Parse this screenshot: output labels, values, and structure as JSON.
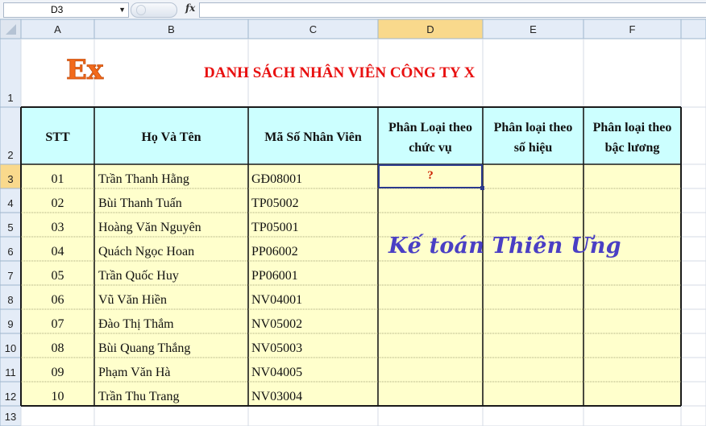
{
  "formula_bar": {
    "name_box": "D3",
    "fx_label": "fx",
    "formula": ""
  },
  "columns": [
    "A",
    "B",
    "C",
    "D",
    "E",
    "F"
  ],
  "rows": [
    "1",
    "2",
    "3",
    "4",
    "5",
    "6",
    "7",
    "8",
    "9",
    "10",
    "11",
    "12",
    "13"
  ],
  "selected": {
    "column": "D",
    "row": "3"
  },
  "title": "DANH SÁCH NHÂN VIÊN CÔNG TY X",
  "logo_text": "Ex",
  "watermark": "Kế toán Thiên Ưng",
  "headers": [
    "STT",
    "Họ Và Tên",
    "Mã Số Nhân Viên",
    "Phân Loại theo chức vụ",
    "Phân loại theo số hiệu",
    "Phân loại theo bậc lương"
  ],
  "header_lines": [
    [
      "STT"
    ],
    [
      "Họ Và Tên"
    ],
    [
      "Mã Số Nhân Viên"
    ],
    [
      "Phân Loại theo",
      "chức vụ"
    ],
    [
      "Phân loại theo",
      "số hiệu"
    ],
    [
      "Phân loại theo",
      "bậc lương"
    ]
  ],
  "table_rows": [
    {
      "stt": "01",
      "name": "Trần Thanh Hằng",
      "code": "GĐ08001",
      "d": "?",
      "e": "",
      "f": ""
    },
    {
      "stt": "02",
      "name": "Bùi Thanh Tuấn",
      "code": "TP05002",
      "d": "",
      "e": "",
      "f": ""
    },
    {
      "stt": "03",
      "name": "Hoàng Văn Nguyên",
      "code": "TP05001",
      "d": "",
      "e": "",
      "f": ""
    },
    {
      "stt": "04",
      "name": "Quách Ngọc Hoan",
      "code": "PP06002",
      "d": "",
      "e": "",
      "f": ""
    },
    {
      "stt": "05",
      "name": "Trần Quốc Huy",
      "code": "PP06001",
      "d": "",
      "e": "",
      "f": ""
    },
    {
      "stt": "06",
      "name": "Vũ Văn Hiền",
      "code": "NV04001",
      "d": "",
      "e": "",
      "f": ""
    },
    {
      "stt": "07",
      "name": "Đào Thị Thắm",
      "code": "NV05002",
      "d": "",
      "e": "",
      "f": ""
    },
    {
      "stt": "08",
      "name": "Bùi Quang Thắng",
      "code": "NV05003",
      "d": "",
      "e": "",
      "f": ""
    },
    {
      "stt": "09",
      "name": "Phạm Văn Hà",
      "code": "NV04005",
      "d": "",
      "e": "",
      "f": ""
    },
    {
      "stt": "10",
      "name": "Trần Thu Trang",
      "code": "NV03004",
      "d": "",
      "e": "",
      "f": ""
    }
  ],
  "colors": {
    "header_fill": "#ccffff",
    "body_fill": "#ffffcc",
    "title": "#e81010",
    "logo": "#f26a1b",
    "watermark": "#4a3fc4",
    "question_mark": "#cc2200",
    "selected_header": "#f9d98c"
  }
}
